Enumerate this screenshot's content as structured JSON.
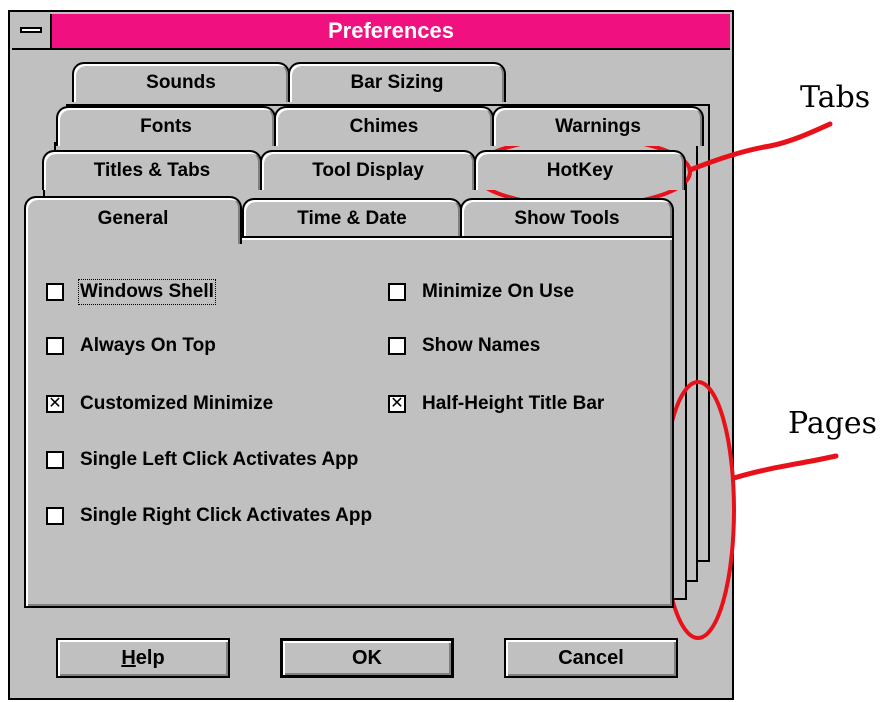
{
  "window": {
    "title": "Preferences"
  },
  "tabs": {
    "row1": [
      "Sounds",
      "Bar Sizing"
    ],
    "row2": [
      "Fonts",
      "Chimes",
      "Warnings"
    ],
    "row3": [
      "Titles & Tabs",
      "Tool Display",
      "HotKey"
    ],
    "row4": [
      "General",
      "Time & Date",
      "Show Tools"
    ],
    "active": "General"
  },
  "options": {
    "windows_shell": {
      "label": "Windows Shell",
      "checked": false
    },
    "minimize_on_use": {
      "label": "Minimize On Use",
      "checked": false
    },
    "always_on_top": {
      "label": "Always On Top",
      "checked": false
    },
    "show_names": {
      "label": "Show Names",
      "checked": false
    },
    "customized_minimize": {
      "label": "Customized Minimize",
      "checked": true
    },
    "half_height_title_bar": {
      "label": "Half-Height Title Bar",
      "checked": true
    },
    "single_left_click": {
      "label": "Single Left Click Activates App",
      "checked": false
    },
    "single_right_click": {
      "label": "Single Right Click Activates App",
      "checked": false
    }
  },
  "buttons": {
    "help_mnemonic": "H",
    "help_rest": "elp",
    "ok": "OK",
    "cancel": "Cancel"
  },
  "annotations": {
    "tabs_label": "Tabs",
    "pages_label": "Pages",
    "color": "#e8111a"
  },
  "colors": {
    "titlebar": "#f0107f",
    "face": "#c0c0c0"
  }
}
